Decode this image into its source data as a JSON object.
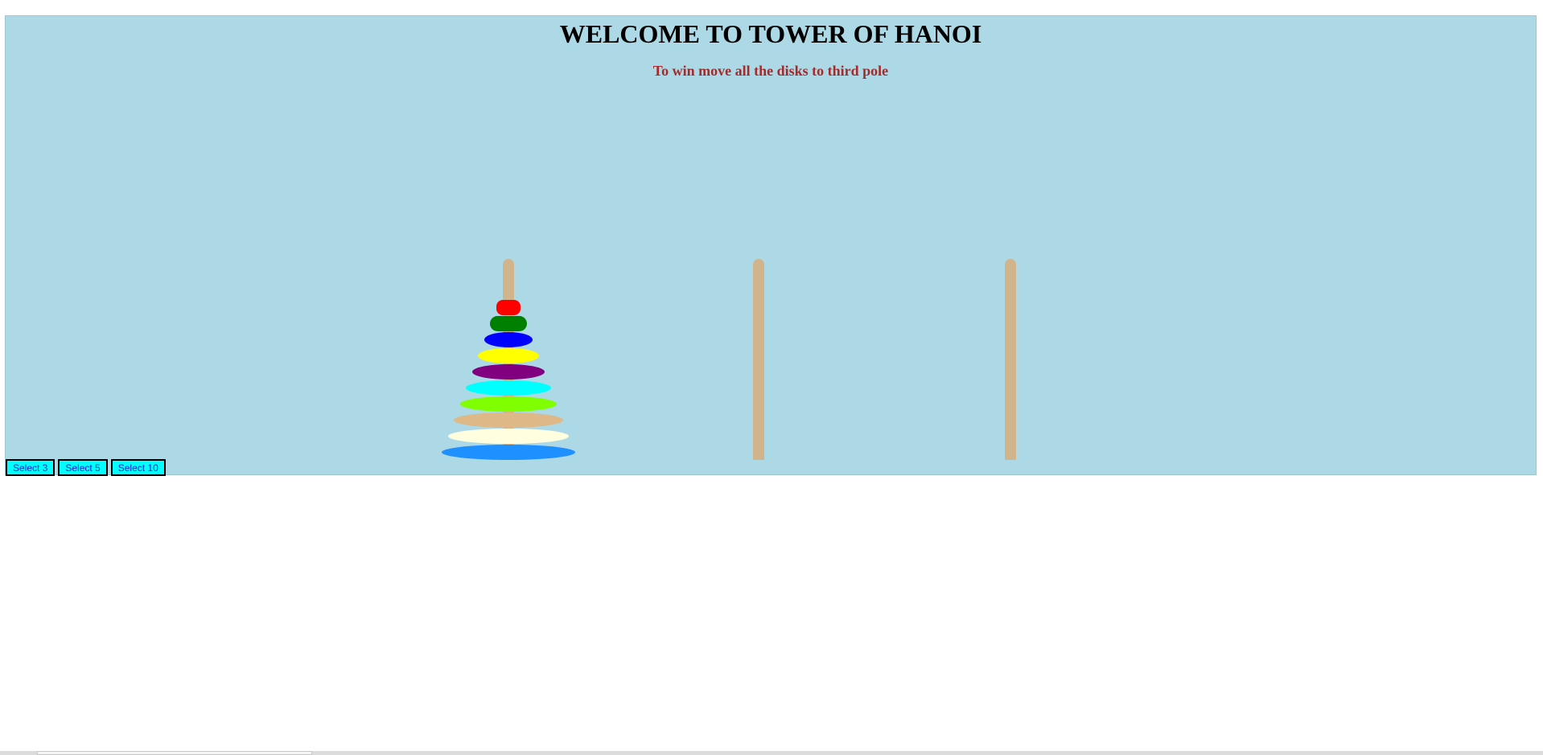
{
  "header": {
    "title": "WELCOME TO TOWER OF HANOI",
    "subtitle": "To win move all the disks to third pole"
  },
  "controls": {
    "buttons": [
      {
        "label": "Select 3"
      },
      {
        "label": "Select 5"
      },
      {
        "label": "Select 10"
      }
    ]
  },
  "game": {
    "pole_count": 3,
    "pole_color": "#d2b48c",
    "background_color": "#add8e6",
    "disks_on_pole_1": [
      {
        "color": "#ff0000",
        "name": "red"
      },
      {
        "color": "#008000",
        "name": "green"
      },
      {
        "color": "#0000ff",
        "name": "blue"
      },
      {
        "color": "#ffff00",
        "name": "yellow"
      },
      {
        "color": "#800080",
        "name": "purple"
      },
      {
        "color": "#00ffff",
        "name": "cyan"
      },
      {
        "color": "#7fff00",
        "name": "chartreuse"
      },
      {
        "color": "#deb887",
        "name": "burlywood"
      },
      {
        "color": "#ffffe0",
        "name": "light-yellow"
      },
      {
        "color": "#1e90ff",
        "name": "dodger-blue"
      }
    ],
    "disks_on_pole_2": [],
    "disks_on_pole_3": []
  }
}
